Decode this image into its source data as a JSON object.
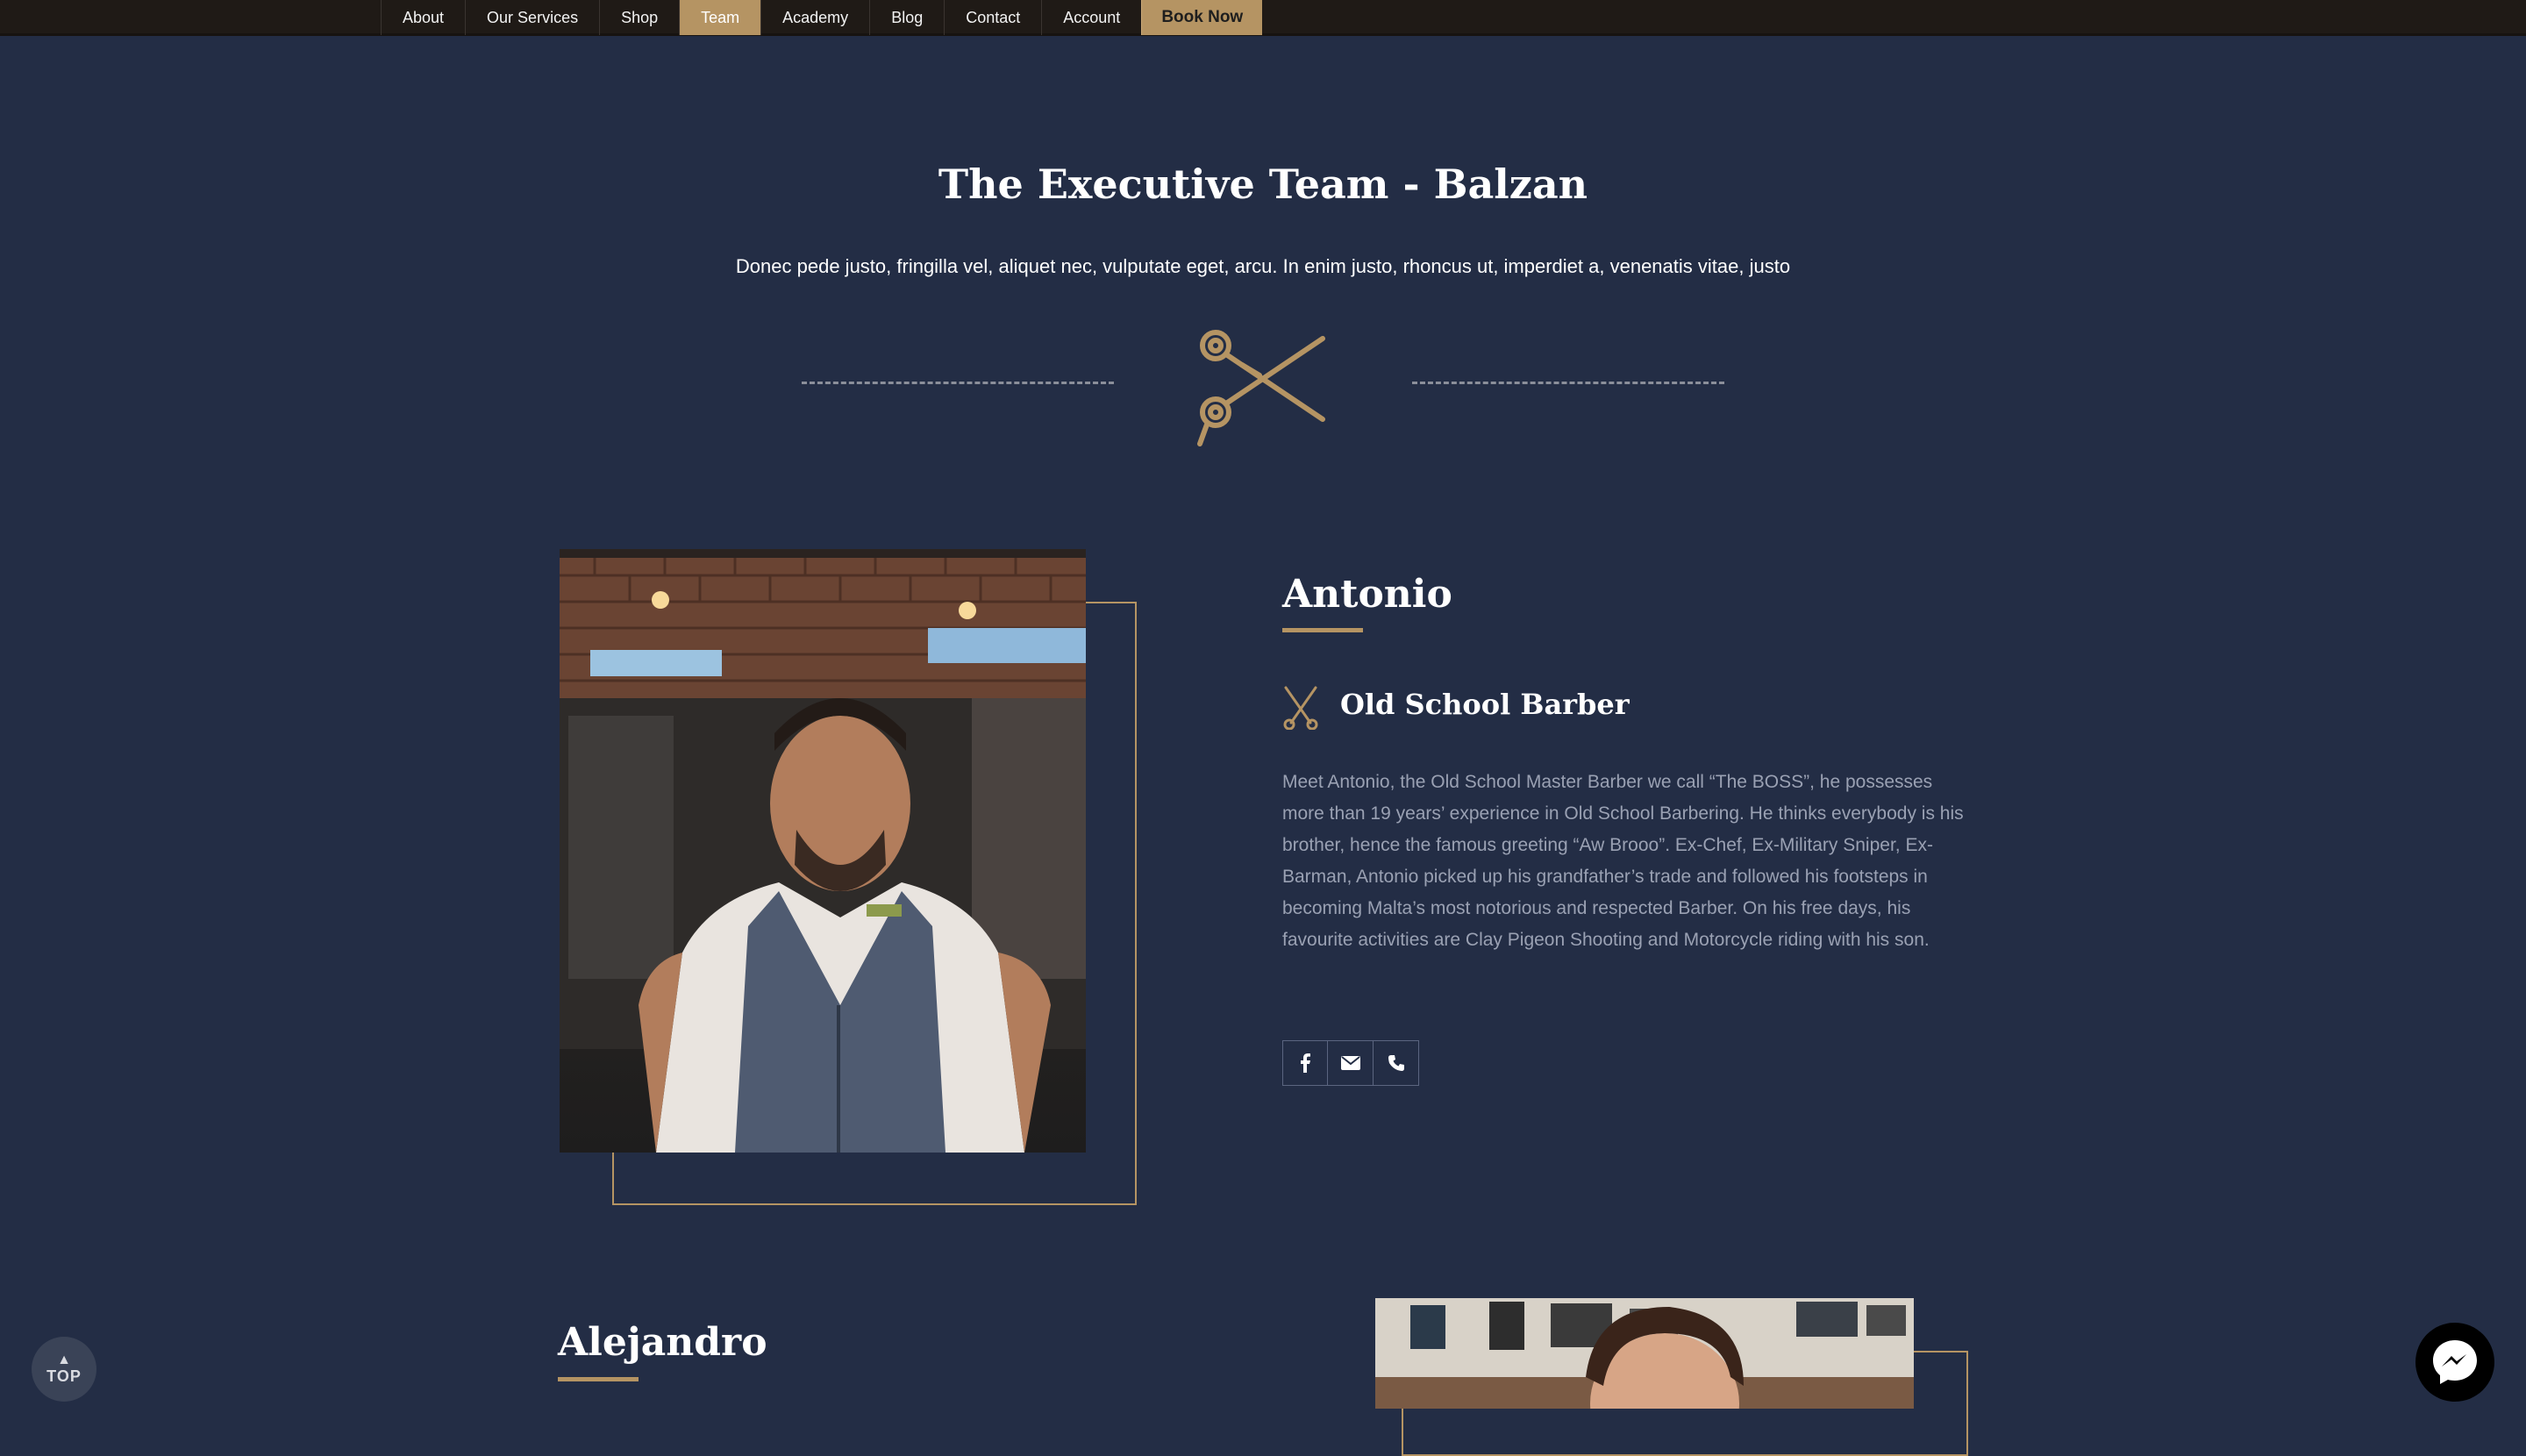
{
  "nav": {
    "items": [
      {
        "label": "About",
        "active": false
      },
      {
        "label": "Our Services",
        "active": false
      },
      {
        "label": "Shop",
        "active": false
      },
      {
        "label": "Team",
        "active": true
      },
      {
        "label": "Academy",
        "active": false
      },
      {
        "label": "Blog",
        "active": false
      },
      {
        "label": "Contact",
        "active": false
      },
      {
        "label": "Account",
        "active": false
      }
    ],
    "cta_label": "Book Now"
  },
  "hero": {
    "title": "The Executive Team - Balzan",
    "subtitle": "Donec pede justo, fringilla vel, aliquet nec, vulputate eget, arcu. In enim justo, rhoncus ut, imperdiet a, venenatis vitae, justo",
    "divider_icon": "scissors-icon"
  },
  "members": [
    {
      "name": "Antonio",
      "role": "Old School Barber",
      "bio": "Meet Antonio, the Old School Master Barber we call “The BOSS”, he possesses more than 19 years’ experience in Old School Barbering. He thinks everybody is his brother, hence the famous greeting “Aw Brooo”. Ex-Chef, Ex-Military Sniper, Ex-Barman, Antonio picked up his grandfather’s trade and followed his footsteps in becoming Malta’s most notorious and respected Barber. On his free days, his favourite activities are Clay Pigeon Shooting and Motorcycle riding with his son.",
      "social": [
        "facebook-icon",
        "email-icon",
        "phone-icon"
      ]
    },
    {
      "name": "Alejandro"
    }
  ],
  "floating": {
    "top_label": "TOP",
    "chat_icon": "messenger-icon"
  },
  "colors": {
    "background": "#232d45",
    "accent": "#b59463",
    "nav_bg": "#1f1a16",
    "body_text": "#9aa1b3"
  }
}
